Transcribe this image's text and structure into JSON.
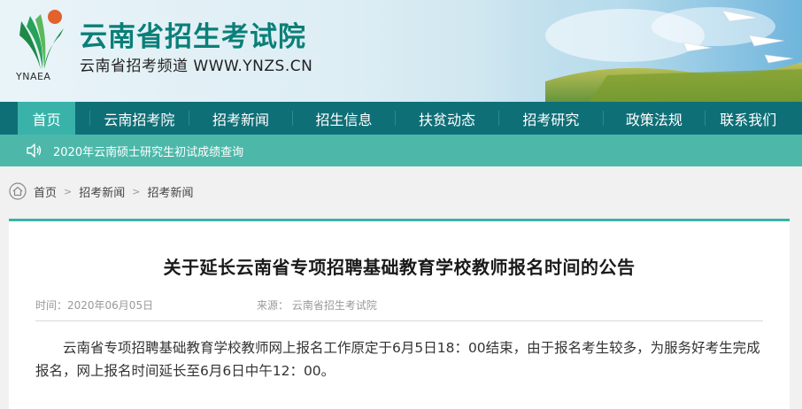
{
  "header": {
    "logo_abbr": "YNAEA",
    "site_title": "云南省招生考试院",
    "site_subtitle": "云南省招考频道  WWW.YNZS.CN"
  },
  "nav": {
    "items": [
      {
        "label": "首页",
        "active": true
      },
      {
        "label": "云南招考院",
        "active": false
      },
      {
        "label": "招考新闻",
        "active": false
      },
      {
        "label": "招生信息",
        "active": false
      },
      {
        "label": "扶贫动态",
        "active": false
      },
      {
        "label": "招考研究",
        "active": false
      },
      {
        "label": "政策法规",
        "active": false
      },
      {
        "label": "联系我们",
        "active": false
      }
    ]
  },
  "notice": {
    "text": "2020年云南硕士研究生初试成绩查询"
  },
  "breadcrumb": {
    "items": [
      "首页",
      "招考新闻",
      "招考新闻"
    ]
  },
  "article": {
    "title": "关于延长云南省专项招聘基础教育学校教师报名时间的公告",
    "time": "时间：2020年06月05日",
    "source": "来源： 云南省招生考试院",
    "body": "云南省专项招聘基础教育学校教师网上报名工作原定于6月5日18：00结束，由于报名考生较多，为服务好考生完成报名，网上报名时间延长至6月6日中午12：00。"
  },
  "colors": {
    "brand_teal": "#0a7f78",
    "nav_bg": "#0f6f77",
    "nav_active": "#39b3a9",
    "notice_bg": "#4db8aa"
  }
}
